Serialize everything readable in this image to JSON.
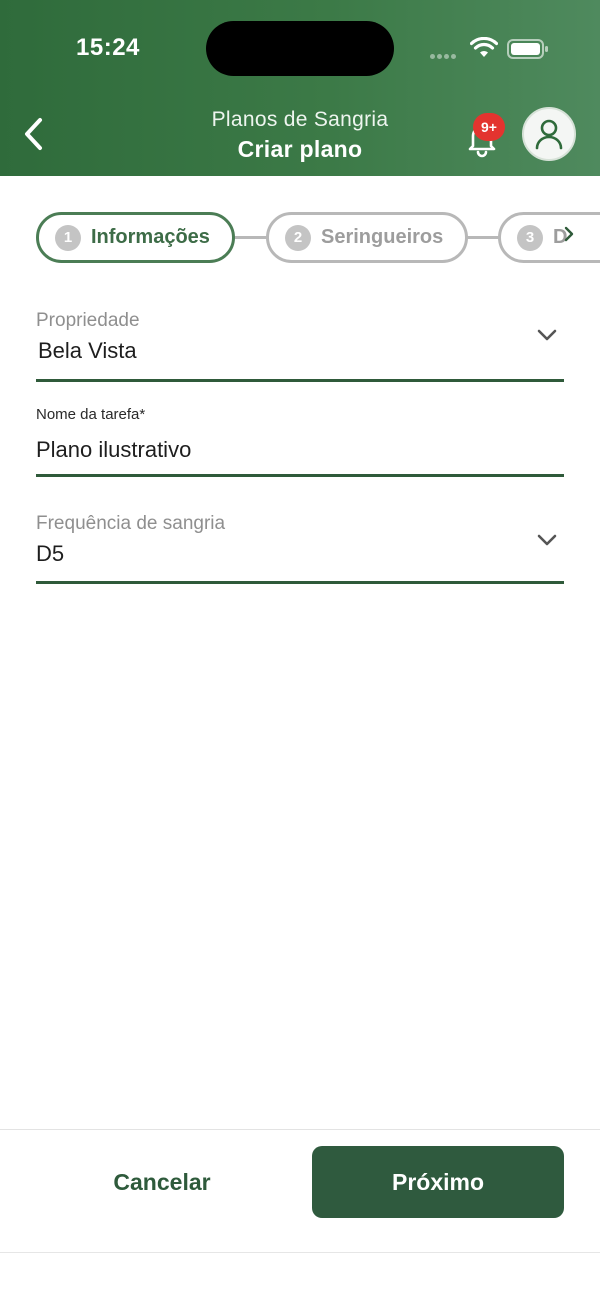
{
  "status_bar": {
    "time": "15:24"
  },
  "header": {
    "subtitle": "Planos de Sangria",
    "title": "Criar plano",
    "notification_count": "9+",
    "icons": [
      "back-icon",
      "bell-icon",
      "user-icon"
    ]
  },
  "stepper": {
    "steps": [
      {
        "number": "1",
        "label": "Informações",
        "active": true
      },
      {
        "number": "2",
        "label": "Seringueiros",
        "active": false
      },
      {
        "number": "3",
        "label": "D",
        "active": false
      }
    ],
    "scroll_icon": "chevron-right-icon"
  },
  "form": {
    "property": {
      "label": "Propriedade",
      "value": "Bela Vista"
    },
    "task_name": {
      "label": "Nome da tarefa*",
      "value": "Plano ilustrativo"
    },
    "frequency": {
      "label": "Frequência de sangria",
      "value": "D5"
    }
  },
  "footer": {
    "cancel_label": "Cancelar",
    "next_label": "Próximo"
  },
  "colors": {
    "header_green": "#3c7a47",
    "primary_dark_green": "#2f5a3e",
    "badge_red": "#e3342f",
    "inactive_gray": "#b8b8b8"
  }
}
